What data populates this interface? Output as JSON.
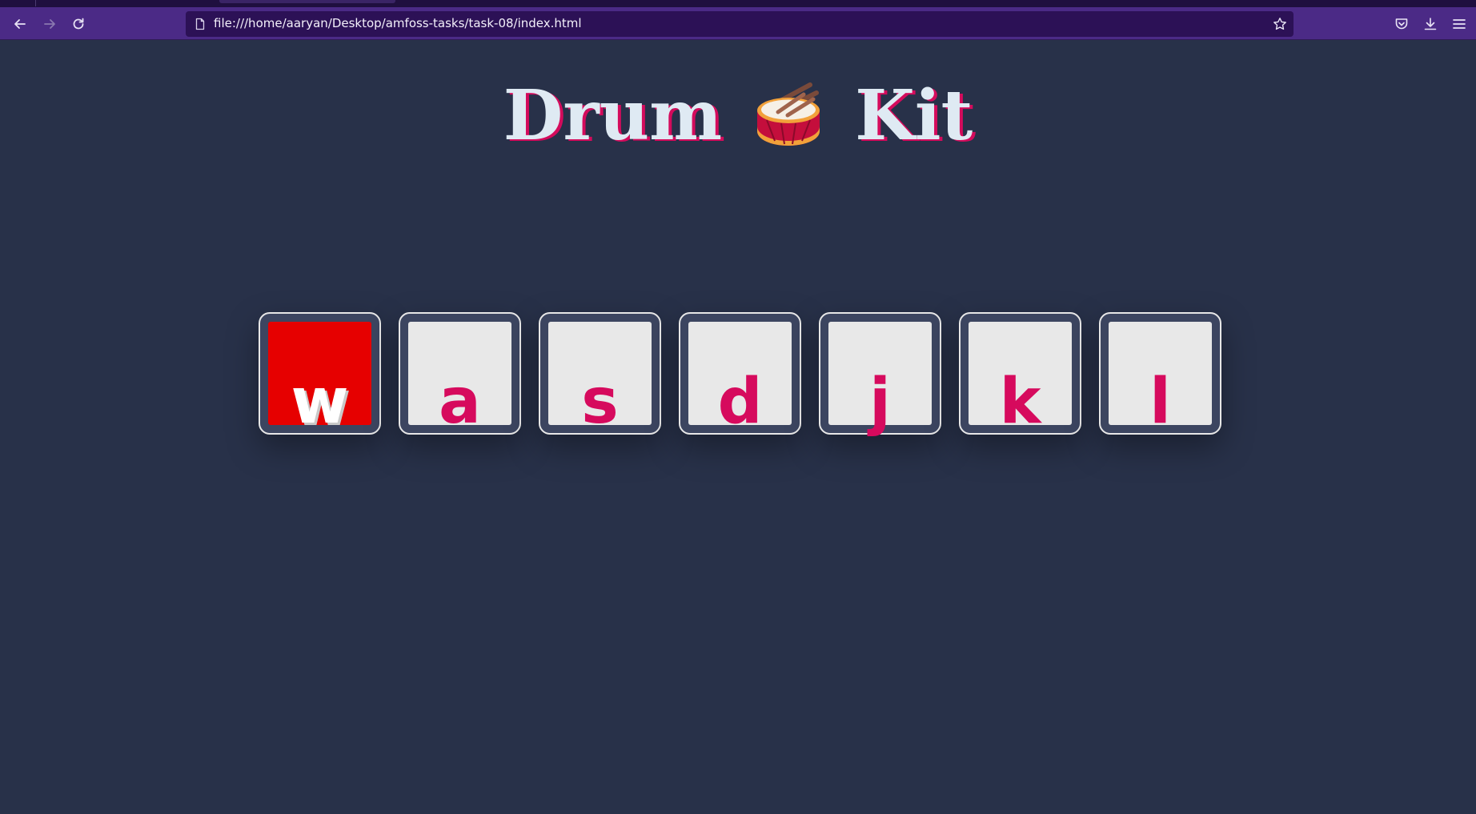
{
  "browser": {
    "url": "file:///home/aaryan/Desktop/amfoss-tasks/task-08/index.html",
    "nav": [
      "back-icon",
      "forward-icon",
      "reload-icon"
    ],
    "right_icons": [
      "pocket-icon",
      "download-icon",
      "menu-icon"
    ]
  },
  "page": {
    "title_left": "Drum",
    "title_icon": "drum-icon",
    "title_right": "Kit",
    "keys": [
      {
        "label": "w",
        "active": true
      },
      {
        "label": "a",
        "active": false
      },
      {
        "label": "s",
        "active": false
      },
      {
        "label": "d",
        "active": false
      },
      {
        "label": "j",
        "active": false
      },
      {
        "label": "k",
        "active": false
      },
      {
        "label": "l",
        "active": false
      }
    ]
  },
  "colors": {
    "background": "#283149",
    "accent": "#d60a5d",
    "active_key": "#e60000",
    "toolbar": "#4b2a86"
  }
}
